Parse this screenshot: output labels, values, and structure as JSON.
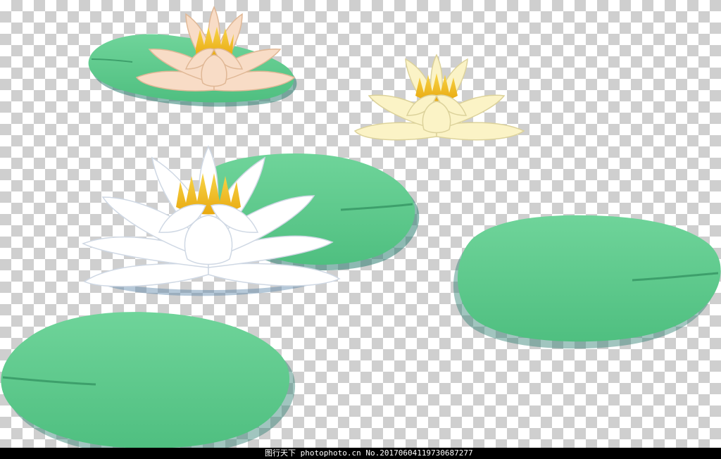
{
  "watermark": {
    "site_label": "图行天下",
    "photo_label": "photophoto.cn",
    "id_text": "No.20170604119730687277"
  },
  "colors": {
    "checker_light": "#ffffff",
    "checker_dark": "#cfcfcf",
    "leaf_fill": "#5ecb8d",
    "leaf_shadow": "#3f9a68",
    "petal_white": "#ffffff",
    "petal_peach": "#f8dcc6",
    "petal_cream": "#fbf3c6",
    "stamen": "#f1c21a",
    "footer_bg": "#000000"
  },
  "illustration": {
    "subject": "water lilies and lily pads",
    "flowers": [
      {
        "name": "peach-water-lily",
        "color": "peach"
      },
      {
        "name": "cream-water-lily",
        "color": "cream"
      },
      {
        "name": "white-water-lily",
        "color": "white"
      }
    ],
    "pads": [
      {
        "name": "lily-pad-top-left"
      },
      {
        "name": "lily-pad-center"
      },
      {
        "name": "lily-pad-right"
      },
      {
        "name": "lily-pad-bottom-left"
      }
    ]
  }
}
